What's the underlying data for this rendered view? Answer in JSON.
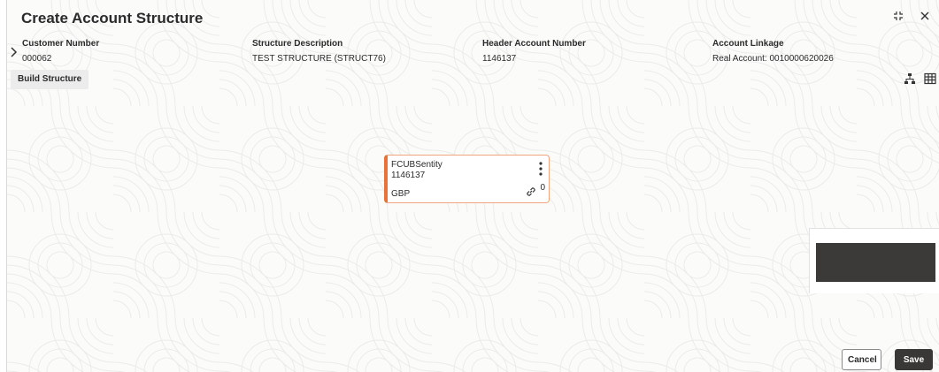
{
  "window": {
    "title": "Create Account Structure",
    "icons": [
      "expand-icon",
      "close-icon"
    ]
  },
  "summary": {
    "fields": [
      {
        "label": "Customer Number",
        "value": "000062"
      },
      {
        "label": "Structure Description",
        "value": "TEST STRUCTURE (STRUCT76)"
      },
      {
        "label": "Header Account Number",
        "value": "1146137"
      },
      {
        "label": "Account Linkage",
        "value": "Real Account: 0010000620026"
      }
    ]
  },
  "tabs": [
    {
      "label": "Build Structure"
    }
  ],
  "toolbar": {
    "icons": [
      "hierarchy-icon",
      "table-view-icon"
    ]
  },
  "node": {
    "entity": "FCUBSentity",
    "account": "1146137",
    "currency": "GBP",
    "link_count": "0",
    "accent_color": "#e8723a"
  },
  "actions": {
    "cancel_label": "Cancel",
    "save_label": "Save"
  }
}
